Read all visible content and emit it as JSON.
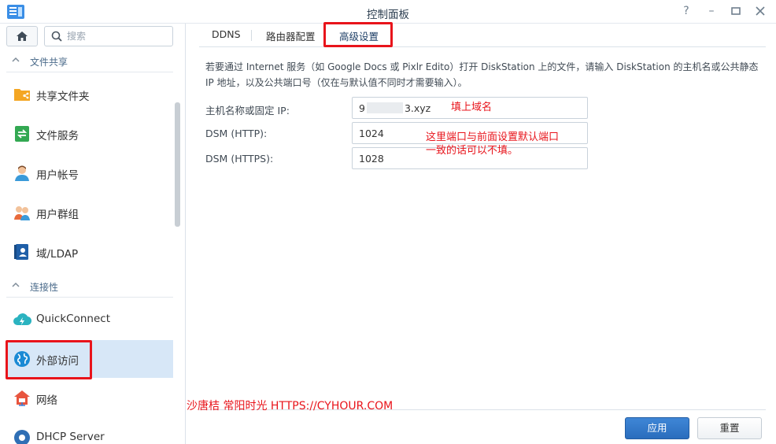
{
  "window": {
    "title": "控制面板",
    "controls": [
      "help-icon",
      "minimize-icon",
      "maximize-icon",
      "close-icon"
    ]
  },
  "sidebar": {
    "search": {
      "placeholder": "搜索",
      "value": ""
    },
    "sections": [
      {
        "label": "文件共享",
        "items": [
          {
            "label": "共享文件夹",
            "icon": "shared-folder-icon"
          },
          {
            "label": "文件服务",
            "icon": "file-services-icon"
          },
          {
            "label": "用户帐号",
            "icon": "user-icon"
          },
          {
            "label": "用户群组",
            "icon": "group-icon"
          },
          {
            "label": "域/LDAP",
            "icon": "domain-ldap-icon"
          }
        ]
      },
      {
        "label": "连接性",
        "items": [
          {
            "label": "QuickConnect",
            "icon": "quickconnect-icon"
          },
          {
            "label": "外部访问",
            "icon": "external-access-icon",
            "active": true
          },
          {
            "label": "网络",
            "icon": "network-icon"
          },
          {
            "label": "DHCP Server",
            "icon": "dhcp-server-icon"
          }
        ]
      }
    ]
  },
  "tabs": [
    {
      "label": "DDNS"
    },
    {
      "label": "路由器配置"
    },
    {
      "label": "高级设置",
      "active": true
    }
  ],
  "content": {
    "description": "若要通过 Internet 服务（如 Google Docs 或 Pixlr Edito）打开 DiskStation 上的文件，请输入 DiskStation 的主机名或公共静态 IP 地址，以及公共端口号（仅在与默认值不同时才需要输入）。",
    "fields": [
      {
        "label": "主机名称或固定 IP:",
        "value_prefix": "9",
        "value_suffix": "3.xyz"
      },
      {
        "label": "DSM (HTTP):",
        "value": "1024"
      },
      {
        "label": "DSM (HTTPS):",
        "value": "1028"
      }
    ],
    "annotations": {
      "host": "填上域名",
      "port_line1": "这里端口与前面设置默认端口",
      "port_line2": "一致的话可以不填。"
    }
  },
  "footer": {
    "watermark": "沙唐桔 常阳时光 HTTPS://CYHOUR.COM",
    "apply_label": "应用",
    "reset_label": "重置"
  },
  "colors": {
    "accent": "#2a6dbd",
    "active_item_bg": "#d7e7f7",
    "highlight_red": "#e8141b"
  }
}
